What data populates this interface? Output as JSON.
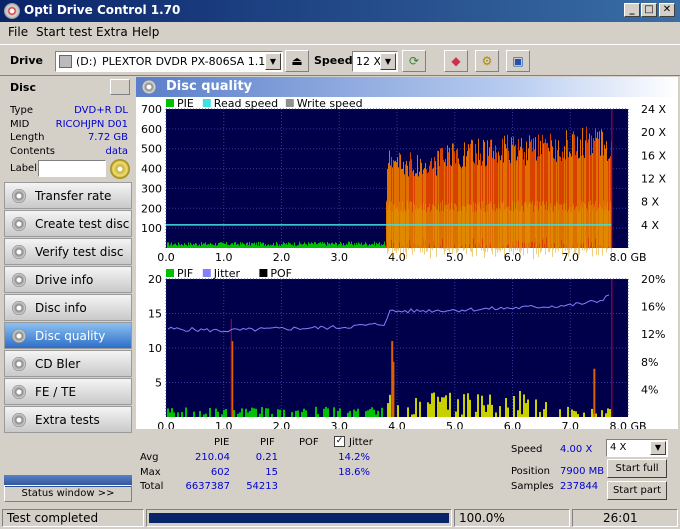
{
  "window": {
    "title": "Opti Drive Control 1.70"
  },
  "menu": [
    "File",
    "Start test",
    "Extra",
    "Help"
  ],
  "toolbar": {
    "drive_label": "Drive",
    "drive_letter": "(D:)",
    "drive_name": "PLEXTOR DVDR   PX-806SA 1.16",
    "speed_label": "Speed",
    "speed_value": "12 X"
  },
  "disc": {
    "header": "Disc",
    "fields": [
      {
        "key": "Type",
        "value": "DVD+R DL"
      },
      {
        "key": "MID",
        "value": "RICOHJPN D01"
      },
      {
        "key": "Length",
        "value": "7.72 GB"
      },
      {
        "key": "Contents",
        "value": "data"
      }
    ],
    "label_key": "Label",
    "label_value": ""
  },
  "nav": [
    "Transfer rate",
    "Create test disc",
    "Verify test disc",
    "Drive info",
    "Disc info",
    "Disc quality",
    "CD Bler",
    "FE / TE",
    "Extra tests"
  ],
  "nav_active": "Disc quality",
  "status_window_label": "Status window >>",
  "panel_title": "Disc quality",
  "chart_data": [
    {
      "type": "bar",
      "legend": [
        "PIE",
        "Read speed",
        "Write speed"
      ],
      "x_ticks": [
        "0.0",
        "1.0",
        "2.0",
        "3.0",
        "4.0",
        "5.0",
        "6.0",
        "7.0",
        "8.0 GB"
      ],
      "y_left_ticks": [
        "700",
        "600",
        "500",
        "400",
        "300",
        "200",
        "100"
      ],
      "y_right_ticks": [
        "24 X",
        "20 X",
        "16 X",
        "12 X",
        "8 X",
        "4 X"
      ],
      "xlim": [
        0,
        8
      ],
      "ylim": [
        0,
        700
      ],
      "y_right_lim": [
        0,
        24
      ],
      "grid": true,
      "pie_profile": {
        "x": [
          0.0,
          3.8,
          3.82,
          4.5,
          5.0,
          5.5,
          6.0,
          6.5,
          7.0,
          7.5,
          7.72
        ],
        "y": [
          20,
          22,
          470,
          440,
          500,
          520,
          530,
          530,
          560,
          580,
          540
        ]
      },
      "read_speed_x": 4.0,
      "read_speed_range_gb": [
        0,
        7.72
      ]
    },
    {
      "type": "bar",
      "legend": [
        "PIF",
        "Jitter",
        "POF"
      ],
      "x_ticks": [
        "0.0",
        "1.0",
        "2.0",
        "3.0",
        "4.0",
        "5.0",
        "6.0",
        "7.0",
        "8.0 GB"
      ],
      "y_left_ticks": [
        "20",
        "15",
        "10",
        "5"
      ],
      "y_right_ticks": [
        "20%",
        "16%",
        "12%",
        "8%",
        "4%"
      ],
      "xlim": [
        0,
        8
      ],
      "ylim": [
        0,
        20
      ],
      "y_right_lim": [
        0,
        20
      ],
      "grid": true,
      "jitter": {
        "x": [
          0.0,
          1.0,
          2.0,
          3.0,
          3.8,
          3.85,
          5.0,
          6.0,
          7.0,
          7.5,
          7.72
        ],
        "y": [
          12.8,
          12.5,
          12.8,
          13.0,
          13.5,
          15.3,
          15.5,
          15.8,
          16.2,
          16.8,
          18.0
        ]
      },
      "pif_peaks": [
        {
          "x": 1.13,
          "y": 11
        },
        {
          "x": 3.9,
          "y": 11
        },
        {
          "x": 3.92,
          "y": 8
        },
        {
          "x": 7.4,
          "y": 7
        }
      ]
    }
  ],
  "stats": {
    "headers": [
      "PIE",
      "PIF",
      "POF"
    ],
    "jitter_label": "Jitter",
    "jitter_checked": true,
    "rows": [
      {
        "label": "Avg",
        "pie": "210.04",
        "pif": "0.21",
        "jitter": "14.2%"
      },
      {
        "label": "Max",
        "pie": "602",
        "pif": "15",
        "jitter": "18.6%"
      },
      {
        "label": "Total",
        "pie": "6637387",
        "pif": "54213",
        "jitter": ""
      }
    ],
    "speed_label": "Speed",
    "speed_value": "4.00 X",
    "speed_select": "4 X",
    "position_label": "Position",
    "position_value": "7900 MB",
    "samples_label": "Samples",
    "samples_value": "237844",
    "start_full": "Start full",
    "start_part": "Start part"
  },
  "status": {
    "text": "Test completed",
    "progress": 1.0,
    "percent": "100.0%",
    "time": "26:01"
  }
}
